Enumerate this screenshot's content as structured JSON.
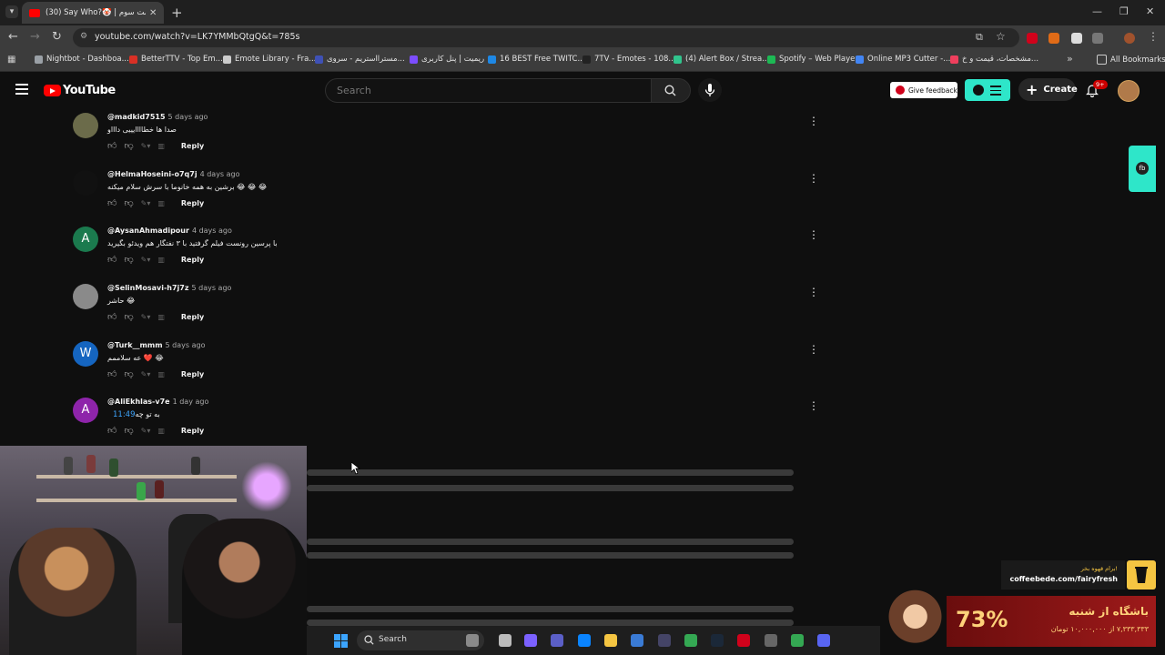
{
  "browser": {
    "tab_title": "(30) Say Who?🤡 | قسمت سوم",
    "url": "youtube.com/watch?v=LK7YMMbQtgQ&t=785s",
    "bookmarks": [
      {
        "label": "Nightbot - Dashboa...",
        "color": "#9aa0a6"
      },
      {
        "label": "BetterTTV - Top Em...",
        "color": "#d93025"
      },
      {
        "label": "Emote Library - Fra...",
        "color": "#cccccc"
      },
      {
        "label": "مسترااستریم - سروی...",
        "color": "#3f51b5"
      },
      {
        "label": "ریمیت | پنل کاربری",
        "color": "#7c4dff"
      },
      {
        "label": "16 BEST Free TWITC...",
        "color": "#1e88e5"
      },
      {
        "label": "7TV - Emotes - 108...",
        "color": "#222222"
      },
      {
        "label": "(4) Alert Box / Strea...",
        "color": "#31c48d"
      },
      {
        "label": "Spotify – Web Player",
        "color": "#1db954"
      },
      {
        "label": "Online MP3 Cutter -...",
        "color": "#4285f4"
      },
      {
        "label": "مشخصات، قیمت و خ...",
        "color": "#ef3f5d"
      }
    ],
    "all_bookmarks": "All Bookmarks"
  },
  "youtube": {
    "logo": "YouTube",
    "search_placeholder": "Search",
    "feedback": "Give feedback",
    "create": "Create",
    "notif_count": "9+"
  },
  "comments": [
    {
      "handle": "@madkid7515",
      "time": "5 days ago",
      "text": "صدا ها خطاااایییی داااو",
      "timestamp": "",
      "avatar_letter": "",
      "avatar_color": "#6b6b4a",
      "reply": "Reply"
    },
    {
      "handle": "@HelmaHoseini-o7q7j",
      "time": "4 days ago",
      "text": "برشین به همه خانوما با سرش سلام میکنه 😂 😂 😂",
      "timestamp": "",
      "avatar_letter": "",
      "avatar_color": "#111111",
      "reply": "Reply"
    },
    {
      "handle": "@AysanAhmadipour",
      "time": "4 days ago",
      "text": "با پرسین رونست فیلم گرفتید با ۳ نفتگار هم ویدئو بگیرید",
      "timestamp": "",
      "avatar_letter": "A",
      "avatar_color": "#1b7a4e",
      "reply": "Reply"
    },
    {
      "handle": "@SelinMosavi-h7j7z",
      "time": "5 days ago",
      "text": "حاشر 😂",
      "timestamp": "",
      "avatar_letter": "",
      "avatar_color": "#8a8a8a",
      "reply": "Reply"
    },
    {
      "handle": "@Turk__mmm",
      "time": "5 days ago",
      "text": "عه سلاممم ❤️ 😂",
      "timestamp": "",
      "avatar_letter": "W",
      "avatar_color": "#1565c0",
      "reply": "Reply"
    },
    {
      "handle": "@AliEkhlas-v7e",
      "time": "1 day ago",
      "text": "به تو چه",
      "timestamp": "11:49",
      "avatar_letter": "A",
      "avatar_color": "#8e24aa",
      "reply": "Reply"
    }
  ],
  "taskbar": {
    "search": "Search"
  },
  "ads": {
    "coffee_line1": "برام قهوه بخر!",
    "coffee_line2": "coffeebede.com/fairyfresh",
    "banner_pct": "73%",
    "banner_title": "باشگاه از شنبه",
    "banner_sub": "۷,۳۳۳,۳۳۳ از ۱۰,۰۰۰,۰۰۰ تومان"
  }
}
